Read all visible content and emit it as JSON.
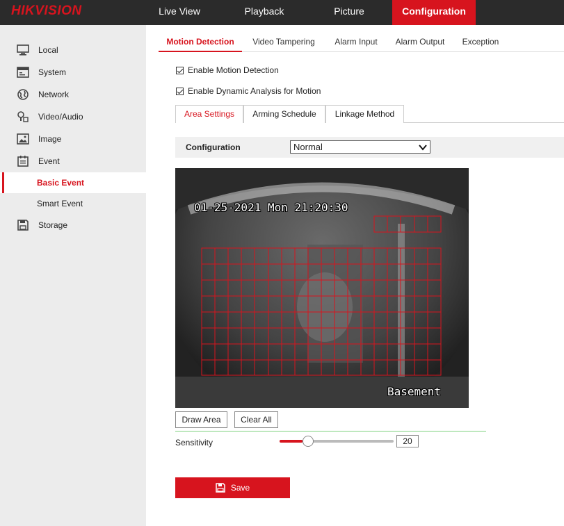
{
  "brand": {
    "logo": "HIKVISION"
  },
  "nav": [
    {
      "label": "Live View"
    },
    {
      "label": "Playback"
    },
    {
      "label": "Picture"
    },
    {
      "label": "Configuration",
      "active": true
    }
  ],
  "sidebar": {
    "items": [
      {
        "label": "Local",
        "icon": "monitor-icon"
      },
      {
        "label": "System",
        "icon": "system-window-icon"
      },
      {
        "label": "Network",
        "icon": "globe-icon"
      },
      {
        "label": "Video/Audio",
        "icon": "microphone-icon"
      },
      {
        "label": "Image",
        "icon": "image-icon"
      },
      {
        "label": "Event",
        "icon": "calendar-list-icon"
      },
      {
        "label": "Storage",
        "icon": "floppy-icon"
      }
    ],
    "subitems": [
      {
        "label": "Basic Event",
        "active": true
      },
      {
        "label": "Smart Event"
      }
    ]
  },
  "tabs": [
    {
      "label": "Motion Detection",
      "active": true
    },
    {
      "label": "Video Tampering"
    },
    {
      "label": "Alarm Input"
    },
    {
      "label": "Alarm Output"
    },
    {
      "label": "Exception"
    }
  ],
  "options": {
    "enable_motion": {
      "label": "Enable Motion Detection",
      "checked": true
    },
    "enable_dynamic": {
      "label": "Enable Dynamic Analysis for Motion",
      "checked": true
    }
  },
  "subtabs": [
    {
      "label": "Area Settings",
      "active": true
    },
    {
      "label": "Arming Schedule"
    },
    {
      "label": "Linkage Method"
    }
  ],
  "configuration": {
    "label": "Configuration",
    "value": "Normal"
  },
  "video": {
    "timestamp": "01-25-2021 Mon 21:20:30",
    "channel_name": "Basement"
  },
  "buttons": {
    "draw_area": "Draw Area",
    "clear_all": "Clear All",
    "save": "Save"
  },
  "sensitivity": {
    "label": "Sensitivity",
    "value": "20",
    "level": 0.2
  },
  "colors": {
    "accent": "#d7141e",
    "topbar": "#2b2b2b",
    "sidebar": "#ececec"
  }
}
